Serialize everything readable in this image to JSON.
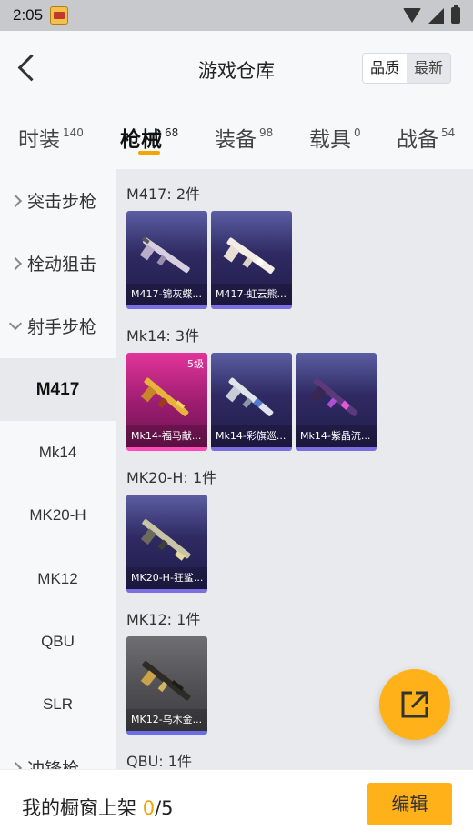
{
  "status_bar": {
    "time": "2:05",
    "icons": [
      "app-icon",
      "wifi-icon",
      "signal-icon",
      "battery-icon"
    ]
  },
  "header": {
    "title": "游戏仓库",
    "sort": {
      "quality_label": "品质",
      "latest_label": "最新"
    }
  },
  "tabs": [
    {
      "label": "时装",
      "count": "140"
    },
    {
      "label": "枪械",
      "count": "68"
    },
    {
      "label": "装备",
      "count": "98"
    },
    {
      "label": "载具",
      "count": "0"
    },
    {
      "label": "战备",
      "count": "54"
    }
  ],
  "active_tab": "枪械",
  "accent_color": "#f5a400",
  "sidebar": {
    "categories": [
      {
        "label": "突击步枪"
      },
      {
        "label": "栓动狙击"
      },
      {
        "label": "射手步枪"
      },
      {
        "label": "冲锋枪"
      }
    ],
    "sub_items": [
      "M417",
      "Mk14",
      "MK20-H",
      "MK12",
      "QBU",
      "SLR"
    ],
    "active_sub": "M417"
  },
  "groups": [
    {
      "heading": "M417: 2件",
      "items": [
        {
          "name": "M417-锦灰蝶...",
          "style": "purple"
        },
        {
          "name": "M417-虹云熊...",
          "style": "purple"
        }
      ]
    },
    {
      "heading": "Mk14: 3件",
      "items": [
        {
          "name": "Mk14-福马献...",
          "style": "pink",
          "level": "5级"
        },
        {
          "name": "Mk14-彩旗巡...",
          "style": "purple"
        },
        {
          "name": "Mk14-紫晶流...",
          "style": "purple"
        }
      ]
    },
    {
      "heading": "MK20-H: 1件",
      "items": [
        {
          "name": "MK20-H-狂鲨...",
          "style": "purple"
        }
      ]
    },
    {
      "heading": "MK12: 1件",
      "items": [
        {
          "name": "MK12-乌木金...",
          "style": "grey"
        }
      ]
    },
    {
      "heading": "QBU: 1件",
      "items": []
    }
  ],
  "bottom_bar": {
    "shelf_label": "我的橱窗上架",
    "shelf_current": "0",
    "shelf_total": "/5",
    "edit_label": "编辑"
  },
  "fab": {
    "icon": "share-icon"
  }
}
